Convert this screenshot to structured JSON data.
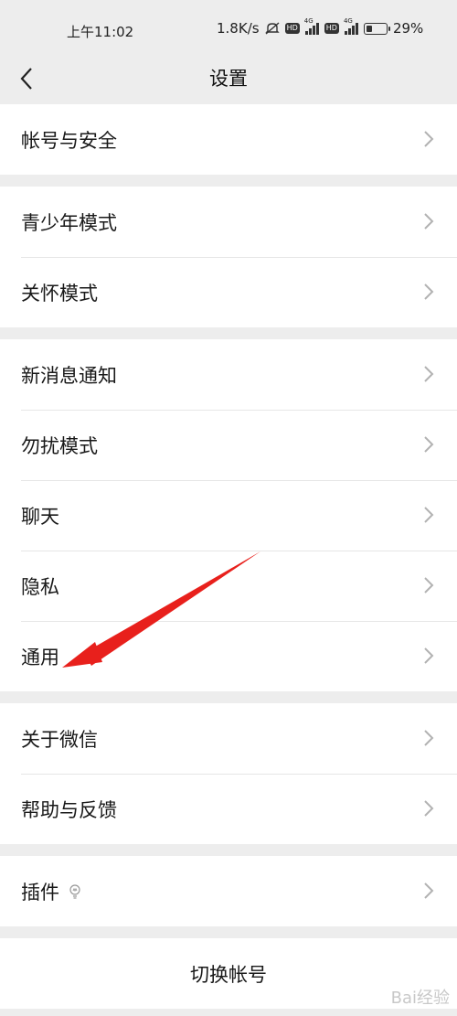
{
  "status_bar": {
    "time": "上午11:02",
    "network_speed": "1.8K/s",
    "battery": "29%",
    "battery_level": 0.29,
    "signal_label_1": "4G",
    "signal_label_2": "4G",
    "hd_1": "HD",
    "hd_2": "HD"
  },
  "navbar": {
    "title": "设置"
  },
  "groups": [
    {
      "items": [
        "帐号与安全"
      ]
    },
    {
      "items": [
        "青少年模式",
        "关怀模式"
      ]
    },
    {
      "items": [
        "新消息通知",
        "勿扰模式",
        "聊天",
        "隐私",
        "通用"
      ]
    },
    {
      "items": [
        "关于微信",
        "帮助与反馈"
      ]
    },
    {
      "items": [
        "插件"
      ]
    }
  ],
  "switch_account": "切换帐号",
  "annotation": {
    "arrow_color": "#e8201c",
    "points_to": "通用"
  },
  "watermark": "Bai经验",
  "colors": {
    "background": "#ededed",
    "cell": "#ffffff",
    "chevron": "#b2b2b2"
  }
}
